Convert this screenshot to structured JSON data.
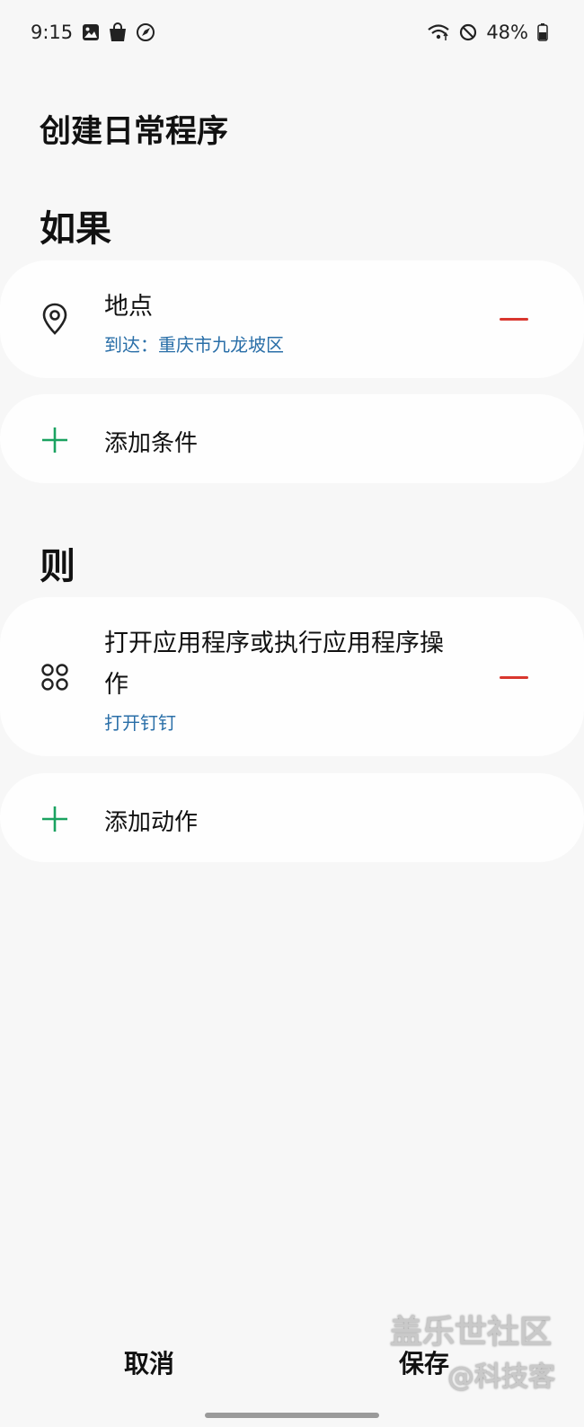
{
  "status_bar": {
    "time": "9:15",
    "icons_left": [
      "gallery-icon",
      "shopping-bag-icon",
      "rocket-icon"
    ],
    "icons_right": [
      "wifi-icon",
      "do-not-disturb-icon",
      "battery-icon"
    ],
    "battery": "48%"
  },
  "page": {
    "title": "创建日常程序"
  },
  "if_section": {
    "heading": "如果",
    "condition": {
      "icon": "location-pin-icon",
      "title": "地点",
      "detail": "到达：重庆市九龙坡区"
    },
    "add_condition_label": "添加条件"
  },
  "then_section": {
    "heading": "则",
    "action": {
      "icon": "apps-icon",
      "title_line1": "打开应用程序或执行应用程序操",
      "title_line2": "作",
      "detail": "打开钉钉"
    },
    "add_action_label": "添加动作"
  },
  "bottom_bar": {
    "cancel_label": "取消",
    "save_label": "保存"
  },
  "watermark": {
    "line1": "盖乐世社区",
    "line2": "@科技客"
  },
  "colors": {
    "background": "#f7f7f7",
    "card": "#fefefe",
    "accent_green": "#1aa260",
    "remove_red": "#d9362e",
    "detail_blue": "#2a6fa8"
  }
}
